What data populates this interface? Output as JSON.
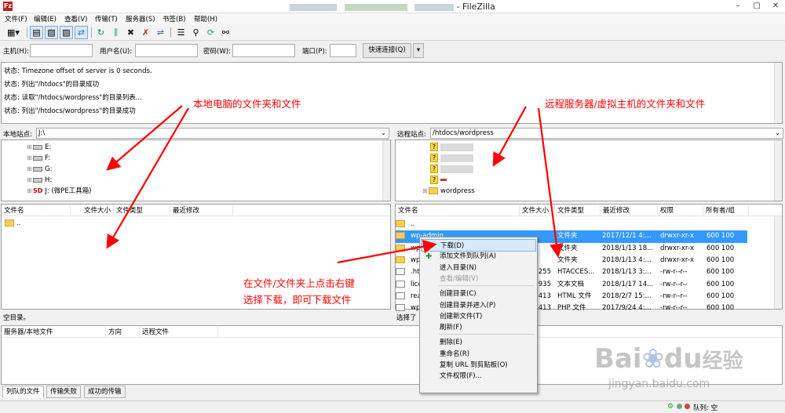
{
  "window": {
    "title_suffix": "- FileZilla",
    "app_icon_letter": "Fz",
    "controls": [
      "–",
      "□",
      "✕"
    ]
  },
  "menu": [
    "文件(F)",
    "编辑(E)",
    "查看(V)",
    "传输(T)",
    "服务器(S)",
    "书签(B)",
    "帮助(H)"
  ],
  "toolbar": {
    "icons": [
      "site-manager-icon",
      "toggle-log-icon",
      "toggle-local-tree-icon",
      "toggle-remote-tree-icon",
      "toggle-queue-icon",
      "refresh-icon",
      "process-queue-icon",
      "cancel-icon",
      "disconnect-icon",
      "reconnect-icon",
      "filter-icon",
      "toggle-compare-icon",
      "sync-browse-icon",
      "search-icon"
    ]
  },
  "quickconnect": {
    "host_label": "主机(H):",
    "user_label": "用户名(U):",
    "pass_label": "密码(W):",
    "port_label": "端口(P):",
    "host_value": "",
    "user_value": "",
    "pass_value": "",
    "port_value": "",
    "button": "快速连接(Q)",
    "dropdown": "▾"
  },
  "log": [
    "状态:  Timezone offset of server is 0 seconds.",
    "状态:  列出\"/htdocs\"的目录成功",
    "状态:  读取\"/htdocs/wordpress\"的目录列表...",
    "状态:  列出\"/htdocs/wordpress\"的目录成功"
  ],
  "local": {
    "site_label": "本地站点:",
    "site_path": "J:\\",
    "tree": [
      {
        "label": "E:",
        "type": "drive"
      },
      {
        "label": "F:",
        "type": "drive"
      },
      {
        "label": "G:",
        "type": "drive"
      },
      {
        "label": "H:",
        "type": "drive"
      },
      {
        "label": "J: (微PE工具箱)",
        "type": "special"
      }
    ],
    "columns": [
      "文件名",
      "文件大小",
      "文件类型",
      "最近修改"
    ],
    "files": [
      ".."
    ],
    "status": "空目录。"
  },
  "remote": {
    "site_label": "远程站点:",
    "site_path": "/htdocs/wordpress",
    "tree": [
      {
        "label": "?",
        "type": "unknown"
      },
      {
        "label": "?",
        "type": "unknown"
      },
      {
        "label": "?",
        "type": "unknown"
      },
      {
        "label": "?",
        "type": "unknown"
      },
      {
        "label": "wordpress",
        "type": "folder"
      }
    ],
    "columns": [
      "文件名",
      "文件大小",
      "文件类型",
      "最近修改",
      "权限",
      "所有者/组"
    ],
    "files": [
      {
        "name": "..",
        "size": "",
        "type": "",
        "modified": "",
        "perm": "",
        "owner": ""
      },
      {
        "name": "wp-admin",
        "size": "",
        "type": "文件夹",
        "modified": "2017/12/1 4:...",
        "perm": "drwxr-xr-x",
        "owner": "600 100",
        "selected": true
      },
      {
        "name": "wp",
        "size": "",
        "type": "文件夹",
        "modified": "2018/1/13 18...",
        "perm": "drwxr-xr-x",
        "owner": "600 100"
      },
      {
        "name": "wp",
        "size": "",
        "type": "文件夹",
        "modified": "2018/1/13 4:...",
        "perm": "drwxr-xr-x",
        "owner": "600 100"
      },
      {
        "name": ".hta",
        "size": "255",
        "type": "HTACCES...",
        "modified": "2018/1/13 3:...",
        "perm": "-rw-r--r--",
        "owner": "600 100"
      },
      {
        "name": "lice",
        "size": "935",
        "type": "文本文档",
        "modified": "2018/1/17 14...",
        "perm": "-rw-r--r--",
        "owner": "600 100"
      },
      {
        "name": "rea",
        "size": "413",
        "type": "HTML 文件",
        "modified": "2018/2/7 15:...",
        "perm": "-rw-r--r--",
        "owner": "600 100"
      },
      {
        "name": "wp",
        "size": "413",
        "type": "PHP 文件",
        "modified": "2017/9/24 4:...",
        "perm": "-rw-r--r--",
        "owner": "600 100"
      }
    ],
    "status": "选择了"
  },
  "queue": {
    "columns": [
      "服务器/本地文件",
      "方向",
      "远程文件"
    ],
    "tabs": [
      "列队的文件",
      "传输失败",
      "成功的传输"
    ]
  },
  "bottom_status": {
    "queue": "队列: 空"
  },
  "context_menu": [
    {
      "label": "下载(D)",
      "highlight": true,
      "icon": "download-icon"
    },
    {
      "label": "添加文件到队列(A)",
      "icon": "add-queue-icon"
    },
    {
      "label": "进入目录(N)"
    },
    {
      "label": "查看/编辑(V)",
      "disabled": true
    },
    {
      "sep": true
    },
    {
      "label": "创建目录(C)"
    },
    {
      "label": "创建目录并进入(P)"
    },
    {
      "label": "创建新文件(T)"
    },
    {
      "label": "刷新(F)"
    },
    {
      "sep": true
    },
    {
      "label": "删除(E)"
    },
    {
      "label": "重命名(R)"
    },
    {
      "label": "复制 URL 到剪贴板(O)"
    },
    {
      "label": "文件权限(F)..."
    }
  ],
  "annotations": {
    "local": "本地电脑的文件夹和文件",
    "remote": "远程服务器/虚拟主机的文件夹和文件",
    "instruction_line1": "在文件/文件夹上点击右键",
    "instruction_line2": "选择下载，即可下载文件",
    "color": "#ff0000"
  },
  "watermark": {
    "brand": "Bai",
    "brand2": "du",
    "cn": "经验",
    "url": "jingyan.baidu.com"
  }
}
